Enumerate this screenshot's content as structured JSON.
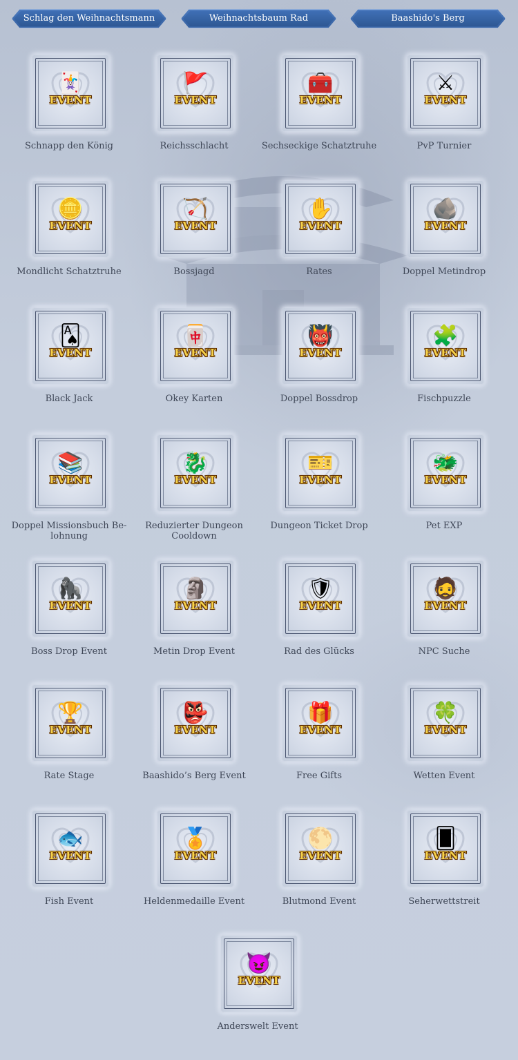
{
  "tabs": [
    {
      "label": "Schlag den Weihnachtsmann"
    },
    {
      "label": "Weihnachtsbaum Rad"
    },
    {
      "label": "Baashido's Berg"
    }
  ],
  "badge_text": "EVENT",
  "events": [
    {
      "label": "Schnapp den König",
      "icon": "cards-crown-icon",
      "glyph": "🃏"
    },
    {
      "label": "Reichsschlacht",
      "icon": "kingdom-cards-icon",
      "glyph": "🚩"
    },
    {
      "label": "Sechseckige Schatztruhe",
      "icon": "hexagonal-chest-icon",
      "glyph": "🧰"
    },
    {
      "label": "PvP Turnier",
      "icon": "crossed-swords-icon",
      "glyph": "⚔"
    },
    {
      "label": "Mondlicht Schatztruhe",
      "icon": "gold-chest-icon",
      "glyph": "🪙"
    },
    {
      "label": "Bossjagd",
      "icon": "cannon-icon",
      "glyph": "🏹"
    },
    {
      "label": "Rates",
      "icon": "green-hand-icon",
      "glyph": "✋"
    },
    {
      "label": "Doppel Metindrop",
      "icon": "metin-stone-icon",
      "glyph": "🪨"
    },
    {
      "label": "Black Jack",
      "icon": "playing-cards-icon",
      "glyph": "🂡"
    },
    {
      "label": "Okey Karten",
      "icon": "okey-cards-icon",
      "glyph": "🀄"
    },
    {
      "label": "Doppel Bossdrop",
      "icon": "boss-monster-icon",
      "glyph": "👹"
    },
    {
      "label": "Fischpuzzle",
      "icon": "puzzle-blocks-icon",
      "glyph": "🧩"
    },
    {
      "label": "Doppel Missionsbuch Be-\nlohnung",
      "icon": "mission-books-icon",
      "glyph": "📚"
    },
    {
      "label": "Reduzierter Dungeon\nCooldown",
      "icon": "dungeon-monster-icon",
      "glyph": "🐉"
    },
    {
      "label": "Dungeon Ticket Drop",
      "icon": "dungeon-tickets-icon",
      "glyph": "🎫"
    },
    {
      "label": "Pet EXP",
      "icon": "pet-dragon-icon",
      "glyph": "🐲"
    },
    {
      "label": "Boss Drop Event",
      "icon": "boss-beast-icon",
      "glyph": "🦍"
    },
    {
      "label": "Metin Drop Event",
      "icon": "metin-golem-icon",
      "glyph": "🗿"
    },
    {
      "label": "Rad des Glücks",
      "icon": "wheel-of-fortune-icon",
      "glyph": "🛡"
    },
    {
      "label": "NPC Suche",
      "icon": "npc-warrior-icon",
      "glyph": "🧔"
    },
    {
      "label": "Rate Stage",
      "icon": "rate-stage-icon",
      "glyph": "🏆"
    },
    {
      "label": "Baashido’s Berg Event",
      "icon": "armored-monster-icon",
      "glyph": "👺"
    },
    {
      "label": "Free Gifts",
      "icon": "gift-girl-icon",
      "glyph": "🎁"
    },
    {
      "label": "Wetten Event",
      "icon": "clover-gold-icon",
      "glyph": "🍀"
    },
    {
      "label": "Fish Event",
      "icon": "fish-icon",
      "glyph": "🐟"
    },
    {
      "label": "Heldenmedaille Event",
      "icon": "hero-medal-icon",
      "glyph": "🏅"
    },
    {
      "label": "Blutmond Event",
      "icon": "blood-moon-icon",
      "glyph": "🌕"
    },
    {
      "label": "Seherwettstreit",
      "icon": "seer-cards-icon",
      "glyph": "🂠"
    },
    {
      "label": "Anderswelt Event",
      "icon": "demon-icon",
      "glyph": "😈"
    }
  ],
  "colors": {
    "tab_blue": "#345f9f",
    "event_gold": "#f6d24a",
    "label_text": "#3e4656",
    "background": "#c3ccdb"
  }
}
